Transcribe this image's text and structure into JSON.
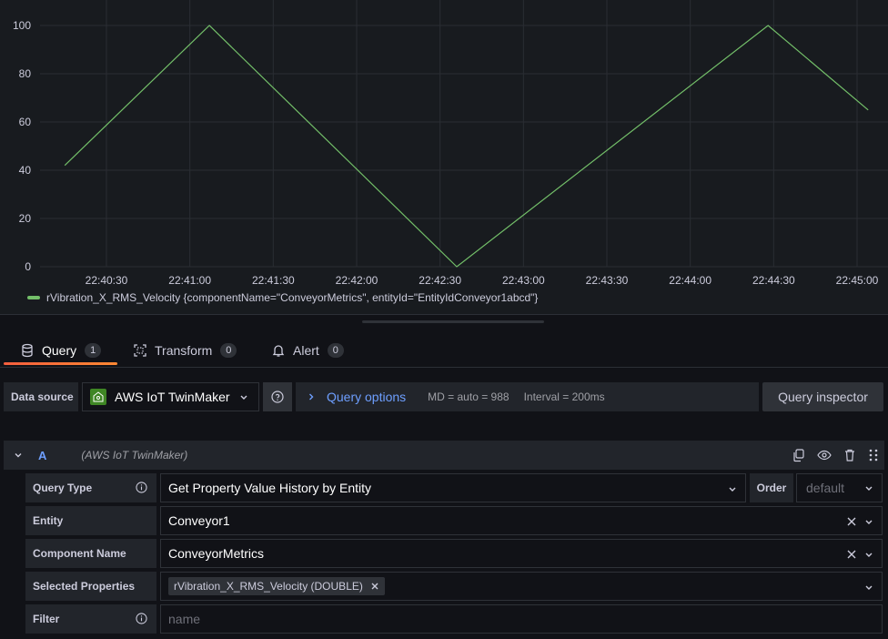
{
  "chart_data": {
    "type": "line",
    "x": [
      "22:40:15",
      "22:41:07",
      "22:42:36",
      "22:44:28",
      "22:45:04"
    ],
    "series": [
      {
        "name": "rVibration_X_RMS_Velocity {componentName=\"ConveyorMetrics\", entityId=\"EntityIdConveyor1abcd\"}",
        "values": [
          42,
          100,
          0,
          100,
          65
        ],
        "color": "#73bf69"
      }
    ],
    "x_ticks": [
      "22:40:30",
      "22:41:00",
      "22:41:30",
      "22:42:00",
      "22:42:30",
      "22:43:00",
      "22:43:30",
      "22:44:00",
      "22:44:30",
      "22:45:00"
    ],
    "y_ticks": [
      "0",
      "20",
      "40",
      "60",
      "80",
      "100"
    ],
    "ylim": [
      0,
      100
    ],
    "grid": true,
    "legend": "bottom-left"
  },
  "tabs": [
    {
      "label": "Query",
      "count": "1",
      "icon": "database-icon"
    },
    {
      "label": "Transform",
      "count": "0",
      "icon": "transform-icon"
    },
    {
      "label": "Alert",
      "count": "0",
      "icon": "bell-icon"
    }
  ],
  "datasource": {
    "label": "Data source",
    "selected": "AWS IoT TwinMaker",
    "query_options_label": "Query options",
    "md": "MD = auto = 988",
    "interval": "Interval = 200ms",
    "inspector_label": "Query inspector"
  },
  "query": {
    "ref_id": "A",
    "datasource_name": "(AWS IoT TwinMaker)",
    "fields": {
      "query_type_label": "Query Type",
      "query_type_value": "Get Property Value History by Entity",
      "order_label": "Order",
      "order_value": "default",
      "entity_label": "Entity",
      "entity_value": "Conveyor1",
      "component_label": "Component Name",
      "component_value": "ConveyorMetrics",
      "properties_label": "Selected Properties",
      "property_chip": "rVibration_X_RMS_Velocity (DOUBLE)",
      "filter_label": "Filter",
      "filter_placeholder": "name"
    }
  },
  "colors": {
    "accent": "#6e9fff",
    "series": "#73bf69",
    "tab_underline": "#f55f3e"
  }
}
